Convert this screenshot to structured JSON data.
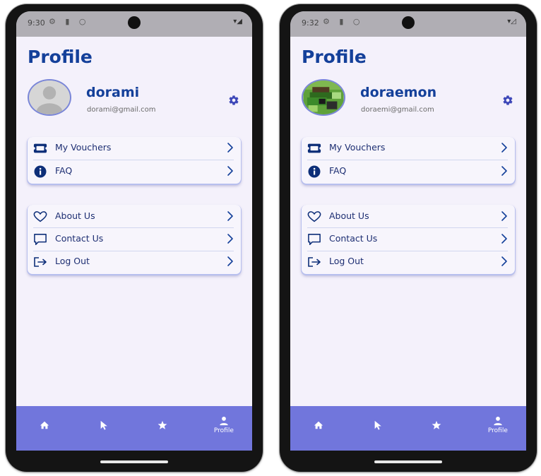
{
  "accent_color": "#14409a",
  "navbar_color": "#7176dc",
  "screens": [
    {
      "status_time": "9:30",
      "status_icons": [
        "settings-cog",
        "sd-card",
        "circle"
      ],
      "page_title": "Profile",
      "user_name": "dorami",
      "user_email": "dorami@gmail.com",
      "avatar": "default-person",
      "menu_primary": [
        {
          "label": "My Vouchers",
          "icon": "ticket-icon"
        },
        {
          "label": "FAQ",
          "icon": "info-icon"
        }
      ],
      "menu_secondary": [
        {
          "label": "About Us",
          "icon": "heart-icon"
        },
        {
          "label": "Contact Us",
          "icon": "chat-icon"
        },
        {
          "label": "Log Out",
          "icon": "logout-icon"
        }
      ],
      "nav": [
        {
          "icon": "home-icon",
          "label": ""
        },
        {
          "icon": "cursor-icon",
          "label": ""
        },
        {
          "icon": "star-icon",
          "label": ""
        },
        {
          "icon": "person-icon",
          "label": "Profile"
        }
      ]
    },
    {
      "status_time": "9:32",
      "status_icons": [
        "settings-cog",
        "sd-card",
        "circle"
      ],
      "page_title": "Profile",
      "user_name": "doraemon",
      "user_email": "doraemi@gmail.com",
      "avatar": "pixel-art",
      "menu_primary": [
        {
          "label": "My Vouchers",
          "icon": "ticket-icon"
        },
        {
          "label": "FAQ",
          "icon": "info-icon"
        }
      ],
      "menu_secondary": [
        {
          "label": "About Us",
          "icon": "heart-icon"
        },
        {
          "label": "Contact Us",
          "icon": "chat-icon"
        },
        {
          "label": "Log Out",
          "icon": "logout-icon"
        }
      ],
      "nav": [
        {
          "icon": "home-icon",
          "label": ""
        },
        {
          "icon": "cursor-icon",
          "label": ""
        },
        {
          "icon": "star-icon",
          "label": ""
        },
        {
          "icon": "person-icon",
          "label": "Profile"
        }
      ]
    }
  ]
}
